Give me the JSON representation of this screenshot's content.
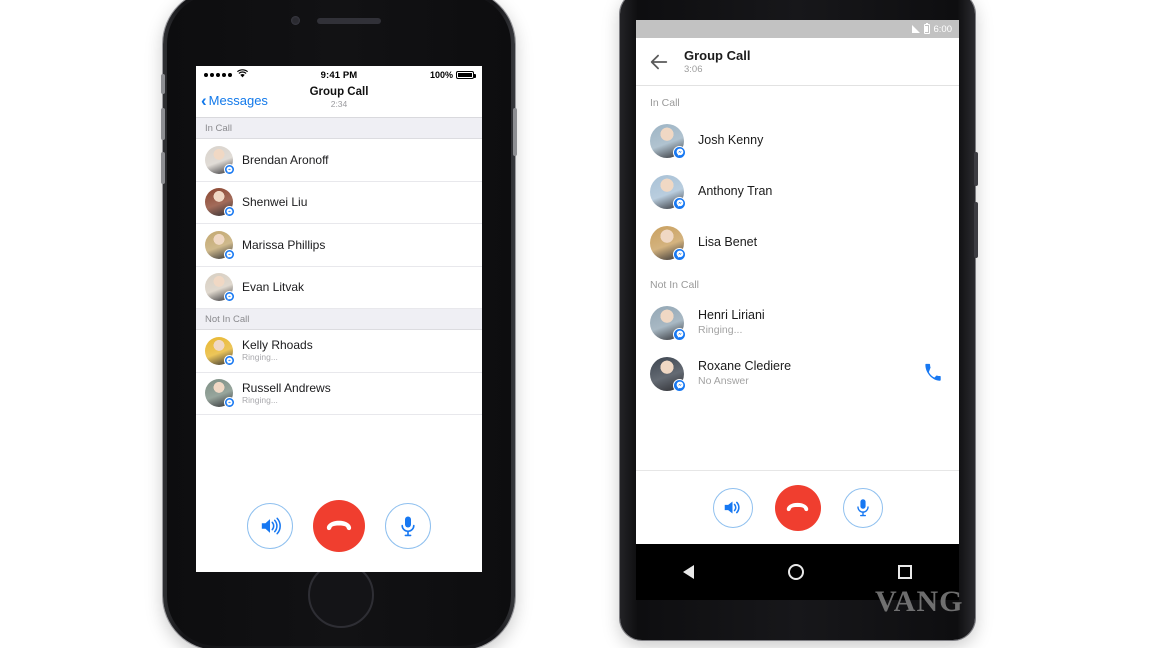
{
  "colors": {
    "ios_blue": "#1279ea",
    "end_call_red": "#f03e2f",
    "messenger_blue": "#1778f2",
    "outline_blue": "#8fc0ef",
    "ios_section_bg": "#efeff4",
    "android_status_bg": "#c2c2c2"
  },
  "iphone": {
    "status_bar": {
      "carrier_dots": "•••••",
      "wifi": "wifi-icon",
      "time": "9:41 PM",
      "battery_percent": "100%"
    },
    "nav": {
      "back_label": "Messages",
      "title": "Group Call",
      "timer": "2:34"
    },
    "sections": [
      {
        "header": "In Call",
        "rows": [
          {
            "name": "Brendan Aronoff",
            "status": "",
            "avatar_color": "#d9d3cc"
          },
          {
            "name": "Shenwei Liu",
            "status": "",
            "avatar_color": "#8b4630"
          },
          {
            "name": "Marissa Phillips",
            "status": "",
            "avatar_color": "#c3a870"
          },
          {
            "name": "Evan Litvak",
            "status": "",
            "avatar_color": "#d8cfc2"
          }
        ]
      },
      {
        "header": "Not In Call",
        "rows": [
          {
            "name": "Kelly Rhoads",
            "status": "Ringing...",
            "avatar_color": "#e8b730"
          },
          {
            "name": "Russell Andrews",
            "status": "Ringing...",
            "avatar_color": "#7d8f84"
          }
        ]
      }
    ],
    "controls": [
      {
        "name": "speaker-button",
        "icon": "speaker-icon"
      },
      {
        "name": "end-call-button",
        "icon": "end-call-icon"
      },
      {
        "name": "mute-button",
        "icon": "microphone-icon"
      }
    ]
  },
  "android": {
    "status_bar": {
      "signal": "signal-icon",
      "battery": "battery-icon",
      "time": "6:00"
    },
    "appbar": {
      "back": "back-arrow-icon",
      "title": "Group Call",
      "timer": "3:06"
    },
    "sections": [
      {
        "header": "In Call",
        "rows": [
          {
            "name": "Josh Kenny",
            "status": "",
            "avatar_color": "#9db4c4",
            "callback": false
          },
          {
            "name": "Anthony Tran",
            "status": "",
            "avatar_color": "#a8c1d6",
            "callback": false
          },
          {
            "name": "Lisa Benet",
            "status": "",
            "avatar_color": "#c9a05f",
            "callback": false
          }
        ]
      },
      {
        "header": "Not In Call",
        "rows": [
          {
            "name": "Henri Liriani",
            "status": "Ringing...",
            "avatar_color": "#93a7b5",
            "callback": false
          },
          {
            "name": "Roxane Clediere",
            "status": "No Answer",
            "avatar_color": "#3d4550",
            "callback": true
          }
        ]
      }
    ],
    "controls": [
      {
        "name": "speaker-button",
        "icon": "speaker-icon"
      },
      {
        "name": "end-call-button",
        "icon": "end-call-icon"
      },
      {
        "name": "mute-button",
        "icon": "microphone-icon"
      }
    ],
    "navbar": [
      {
        "name": "nav-back-button",
        "icon": "triangle-back-icon"
      },
      {
        "name": "nav-home-button",
        "icon": "circle-home-icon"
      },
      {
        "name": "nav-recents-button",
        "icon": "square-recents-icon"
      }
    ]
  },
  "watermark": {
    "text": "VANG"
  }
}
